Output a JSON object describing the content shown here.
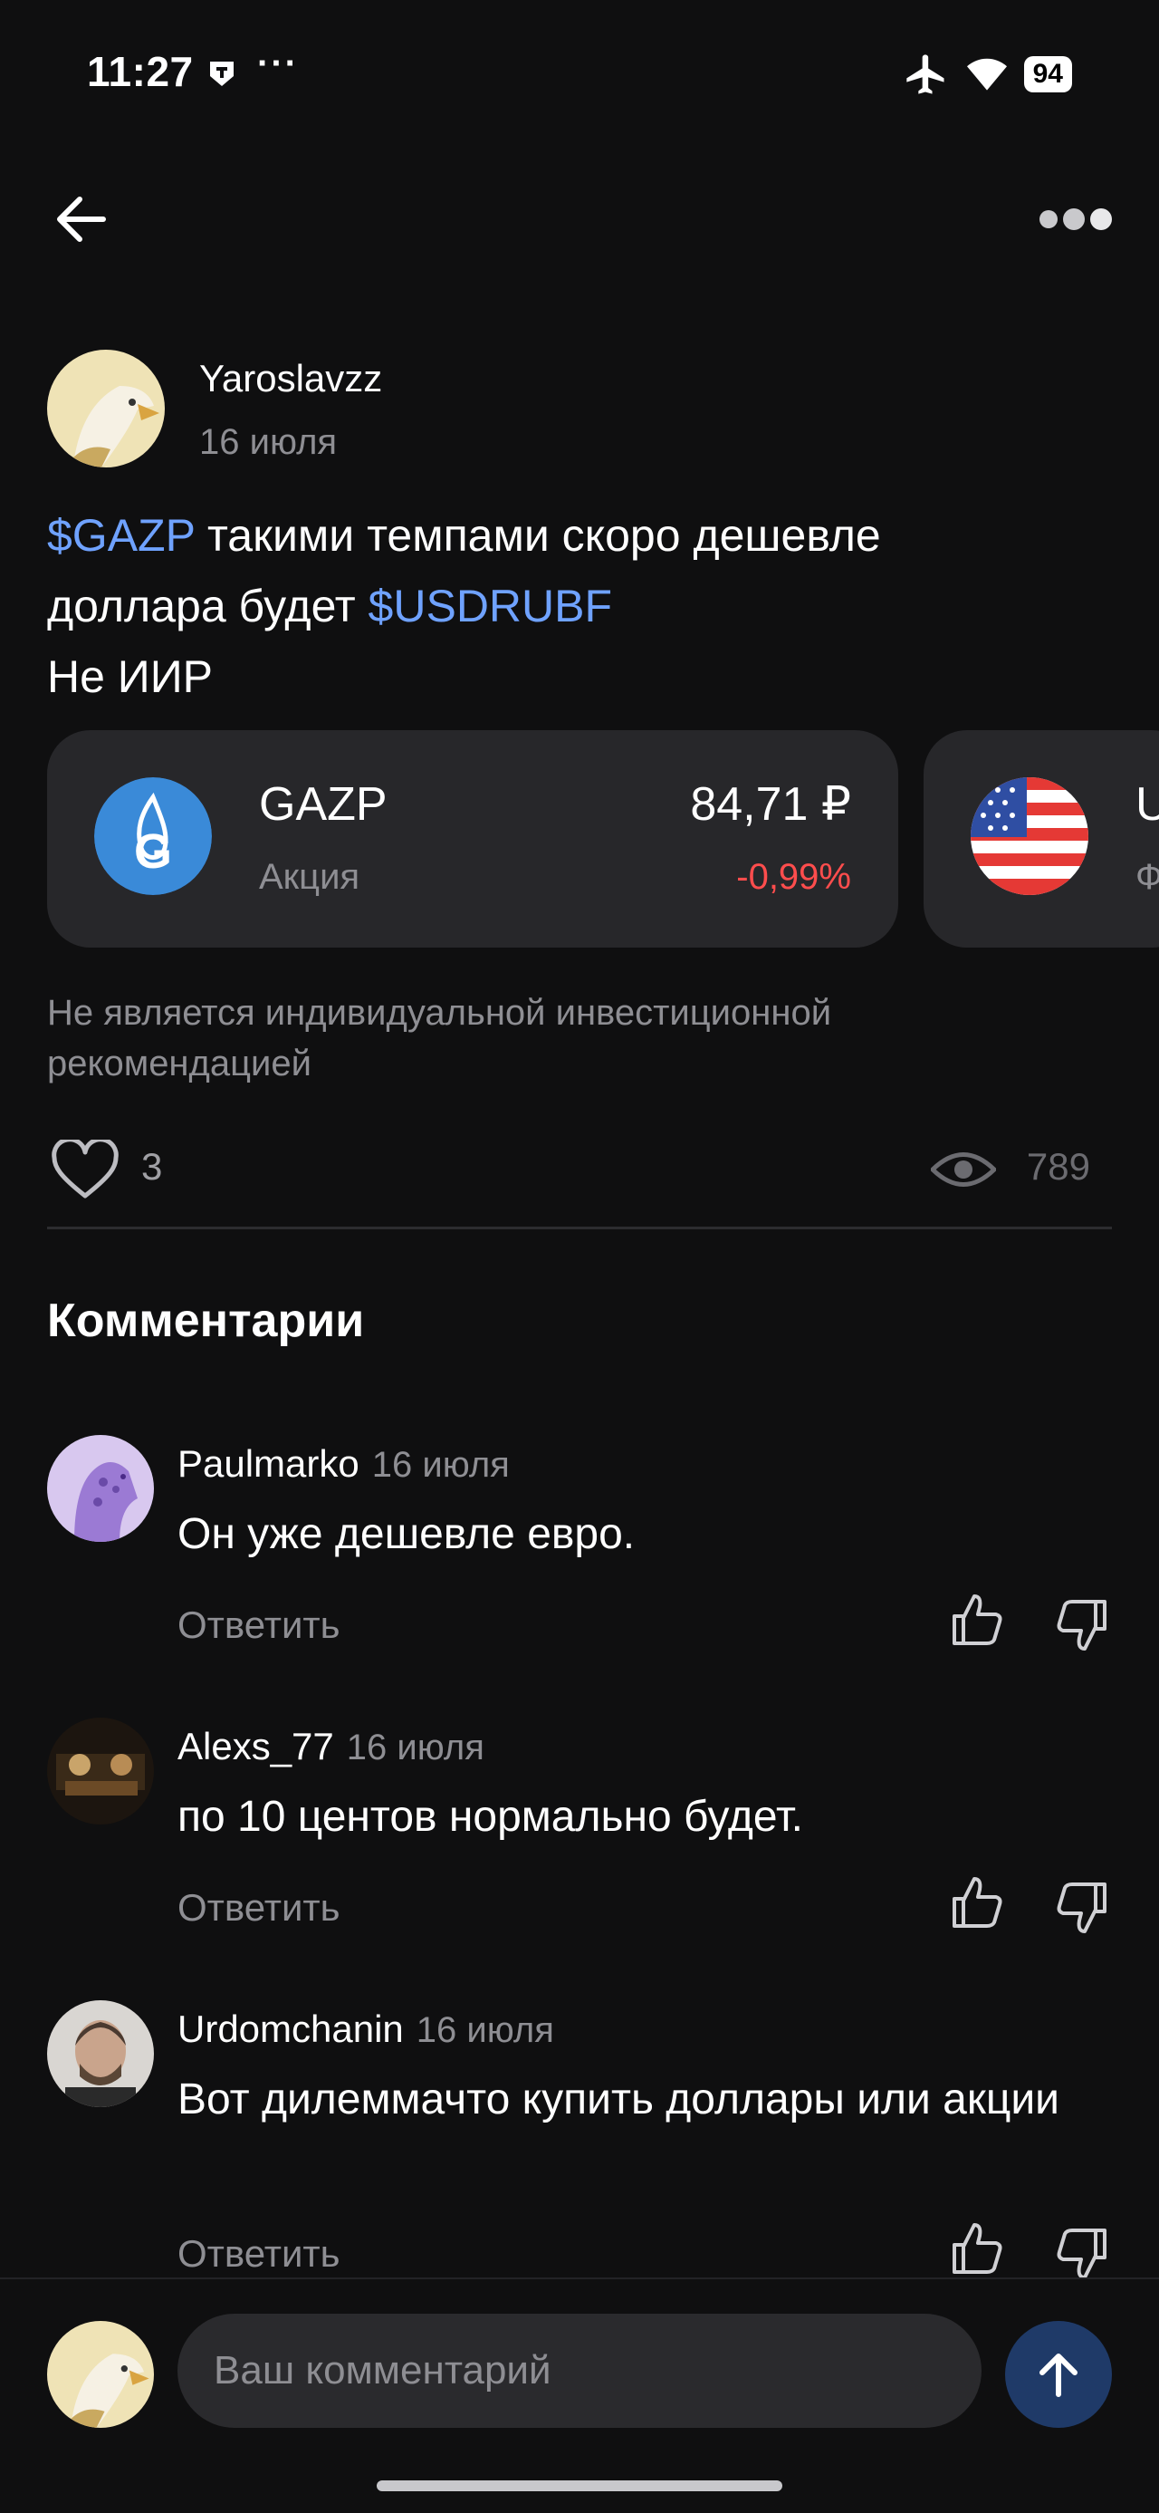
{
  "status_bar": {
    "time": "11:27",
    "dots": "···",
    "battery": "94"
  },
  "post": {
    "author": "Yaroslavzz",
    "date": "16 июля",
    "text_line1_ticker": "$GAZP",
    "text_line1_rest": " такими темпами скоро дешевле",
    "text_line2_start": "доллара будет ",
    "text_line2_ticker": "$USDRUBF",
    "text_line3": "Не ИИР",
    "cards": [
      {
        "name": "GAZP",
        "type": "Акция",
        "price": "84,71 ₽",
        "change": "-0,99%"
      },
      {
        "name": "U",
        "type": "Ф"
      }
    ],
    "disclaimer": "Не является индивидуальной инвестиционной рекомендацией",
    "likes": "3",
    "views": "789"
  },
  "comments_title": "Комментарии",
  "comments": [
    {
      "author": "Paulmarko",
      "date": "16 июля",
      "text": "Он уже дешевле евро.",
      "reply": "Ответить"
    },
    {
      "author": "Alexs_77",
      "date": "16 июля",
      "text": "по 10  центов нормально будет.",
      "reply": "Ответить"
    },
    {
      "author": "Urdomchanin",
      "date": "16 июля",
      "text": "Вот дилеммачто купить доллары или акции",
      "reply": "Ответить"
    }
  ],
  "comment_input": {
    "placeholder": "Ваш комментарий"
  },
  "colors": {
    "background": "#0f0f10",
    "ticker": "#6fa2ff",
    "negative": "#ff4d4d",
    "send": "#1f3a68"
  },
  "icons": [
    "back-arrow-icon",
    "more-icon",
    "heart-icon",
    "eye-icon",
    "thumbs-up-icon",
    "thumbs-down-icon",
    "send-arrow-icon"
  ]
}
